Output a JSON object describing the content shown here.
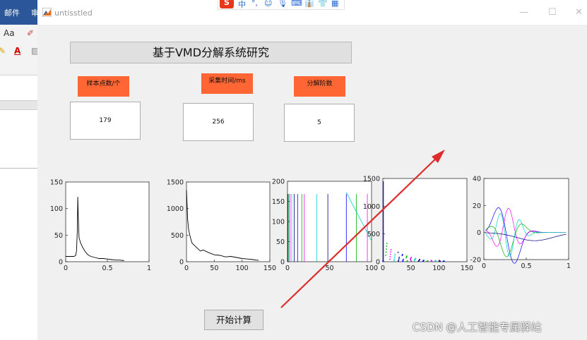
{
  "word": {
    "tabs": [
      "邮件",
      "审"
    ],
    "tools": {
      "aa": "Aa",
      "font_color": "A"
    }
  },
  "window": {
    "title": "untisstled",
    "min": "—",
    "max": "☐",
    "close": "✕"
  },
  "ime": {
    "logo": "S",
    "glyphs": [
      "中",
      "°,",
      "☺",
      "🎙",
      "⌨",
      "👔",
      "👕",
      "▦"
    ]
  },
  "app": {
    "title": "基于VMD分解系统研究",
    "params": [
      {
        "label": "样本点数/个",
        "value": "179"
      },
      {
        "label": "采集时间/ms",
        "value": "256"
      },
      {
        "label": "分解阶数",
        "value": "5"
      }
    ],
    "start_button": "开始计算"
  },
  "watermark": "CSDN @人工智能专属驿站",
  "colors": {
    "orange": "#ff6633",
    "arrow": "#e02b2b"
  },
  "chart_data": [
    {
      "type": "line",
      "series": [
        {
          "x": [
            0,
            0.01,
            0.02,
            0.05,
            0.08,
            0.1,
            0.12,
            0.13,
            0.14,
            0.145,
            0.15,
            0.16,
            0.18,
            0.2,
            0.23,
            0.26,
            0.3,
            0.35,
            0.4,
            0.45,
            0.5,
            0.55,
            0.6,
            0.65,
            0.7
          ],
          "values": [
            10,
            10,
            10,
            10,
            10,
            10,
            12,
            20,
            60,
            122,
            90,
            45,
            35,
            28,
            20,
            14,
            10,
            8,
            6,
            6,
            5,
            4,
            3,
            3,
            2
          ]
        }
      ],
      "xlim": [
        0,
        1
      ],
      "ylim": [
        0,
        150
      ],
      "xticks": [
        "0",
        "0.5",
        "1"
      ],
      "yticks": [
        "0",
        "50",
        "100",
        "150"
      ]
    },
    {
      "type": "line",
      "series": [
        {
          "x": [
            0,
            1,
            2,
            4,
            6,
            8,
            10,
            15,
            20,
            25,
            30,
            40,
            50,
            60,
            70,
            80,
            90,
            100,
            110,
            120,
            125,
            130
          ],
          "values": [
            1350,
            1100,
            800,
            600,
            500,
            420,
            350,
            300,
            250,
            200,
            220,
            170,
            130,
            120,
            90,
            100,
            80,
            60,
            50,
            40,
            30,
            25
          ]
        }
      ],
      "xlim": [
        0,
        150
      ],
      "ylim": [
        0,
        1500
      ],
      "xticks": [
        "0",
        "50",
        "100",
        "150"
      ],
      "yticks": [
        "0",
        "500",
        "1000",
        "1500"
      ]
    },
    {
      "type": "line",
      "series": [],
      "xlim": [
        0,
        100
      ],
      "ylim": [
        0,
        200
      ],
      "xticks": [
        "0",
        "50",
        "100"
      ],
      "yticks": [
        "0",
        "50",
        "100",
        "150",
        "200"
      ]
    },
    {
      "type": "scatter",
      "series": [],
      "xlim": [
        0,
        150
      ],
      "ylim": [
        0,
        1500
      ],
      "xticks": [
        "0",
        "50",
        "100",
        "150"
      ],
      "yticks": [
        "0",
        "500",
        "1000",
        "1500"
      ]
    },
    {
      "type": "line",
      "series": [],
      "xlim": [
        0,
        1
      ],
      "ylim": [
        -20,
        40
      ],
      "xticks": [
        "0",
        "0.5",
        "1"
      ],
      "yticks": [
        "-20",
        "0",
        "20",
        "40"
      ]
    }
  ]
}
